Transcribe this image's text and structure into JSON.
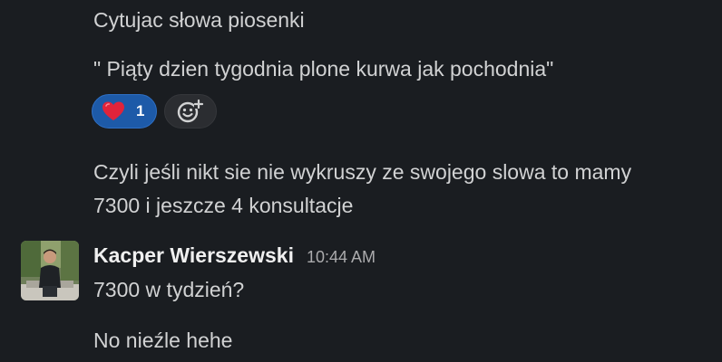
{
  "messages_top": {
    "line1": "Cytujac słowa piosenki",
    "line2": "\" Piąty dzien tygodnia plone kurwa jak pochodnia\""
  },
  "reactions": {
    "heart": {
      "emoji": "heart-emoji",
      "count": "1",
      "color": "#1d5aa8"
    },
    "add_reaction_icon": "add-emoji-icon"
  },
  "message_mid": {
    "line1": "Czyli jeśli nikt sie nie wykruszy ze swojego slowa to mamy",
    "line2": "7300 i jeszcze 4 konsultacje"
  },
  "sender_block": {
    "name": "Kacper Wierszewski",
    "time": "10:44 AM",
    "message1": "7300 w tydzień?",
    "message2": "No nieźle hehe"
  },
  "colors": {
    "background": "#1a1d21",
    "text": "#d1d2d3",
    "reaction_active": "#1d5aa8"
  }
}
